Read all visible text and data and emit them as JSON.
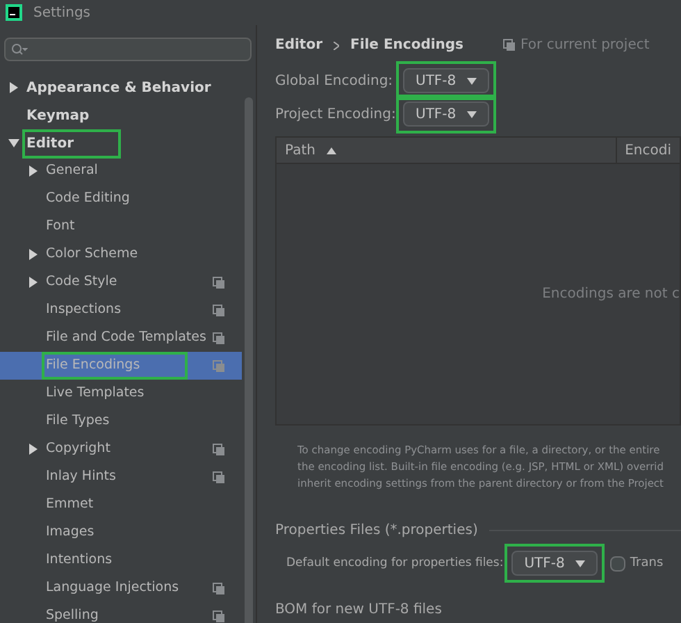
{
  "window": {
    "title": "Settings"
  },
  "sidebar": {
    "items": [
      {
        "label": "Appearance & Behavior",
        "expanded": false,
        "selected": false,
        "highlighted": false,
        "project_scoped": false
      },
      {
        "label": "Keymap",
        "selected": false,
        "highlighted": false,
        "project_scoped": false
      },
      {
        "label": "Editor",
        "expanded": true,
        "selected": false,
        "highlighted": true,
        "project_scoped": false,
        "children": [
          {
            "label": "General",
            "expanded": false,
            "selected": false,
            "highlighted": false,
            "project_scoped": false
          },
          {
            "label": "Code Editing",
            "selected": false,
            "highlighted": false,
            "project_scoped": false
          },
          {
            "label": "Font",
            "selected": false,
            "highlighted": false,
            "project_scoped": false
          },
          {
            "label": "Color Scheme",
            "expanded": false,
            "selected": false,
            "highlighted": false,
            "project_scoped": false
          },
          {
            "label": "Code Style",
            "expanded": false,
            "selected": false,
            "highlighted": false,
            "project_scoped": true
          },
          {
            "label": "Inspections",
            "selected": false,
            "highlighted": false,
            "project_scoped": true
          },
          {
            "label": "File and Code Templates",
            "selected": false,
            "highlighted": false,
            "project_scoped": true
          },
          {
            "label": "File Encodings",
            "selected": true,
            "highlighted": true,
            "project_scoped": true
          },
          {
            "label": "Live Templates",
            "selected": false,
            "highlighted": false,
            "project_scoped": false
          },
          {
            "label": "File Types",
            "selected": false,
            "highlighted": false,
            "project_scoped": false
          },
          {
            "label": "Copyright",
            "expanded": false,
            "selected": false,
            "highlighted": false,
            "project_scoped": true
          },
          {
            "label": "Inlay Hints",
            "selected": false,
            "highlighted": false,
            "project_scoped": true
          },
          {
            "label": "Emmet",
            "selected": false,
            "highlighted": false,
            "project_scoped": false
          },
          {
            "label": "Images",
            "selected": false,
            "highlighted": false,
            "project_scoped": false
          },
          {
            "label": "Intentions",
            "selected": false,
            "highlighted": false,
            "project_scoped": false
          },
          {
            "label": "Language Injections",
            "selected": false,
            "highlighted": false,
            "project_scoped": true
          },
          {
            "label": "Spelling",
            "selected": false,
            "highlighted": false,
            "project_scoped": true
          }
        ]
      }
    ]
  },
  "breadcrumb": [
    "Editor",
    "File Encodings"
  ],
  "scope_note": "For current project",
  "encodings": [
    {
      "label": "Global Encoding:",
      "value": "UTF-8",
      "highlighted": true
    },
    {
      "label": "Project Encoding:",
      "value": "UTF-8",
      "highlighted": true
    }
  ],
  "table": {
    "columns": [
      {
        "label": "Path",
        "sorted_ascending": true
      },
      {
        "label": "Encodi"
      }
    ],
    "empty_text": "Encodings are not c"
  },
  "description": [
    "To change encoding PyCharm uses for a file, a directory, or the entire",
    "the encoding list. Built-in file encoding (e.g. JSP, HTML or XML) overrid",
    "inherit encoding settings from the parent directory or from the Project"
  ],
  "properties": {
    "title": "Properties Files (*.properties)",
    "label": "Default encoding for properties files:",
    "value": "UTF-8",
    "highlighted": true,
    "checkbox": {
      "label": "Trans",
      "checked": false
    }
  },
  "bom_title": "BOM for new UTF-8 files"
}
